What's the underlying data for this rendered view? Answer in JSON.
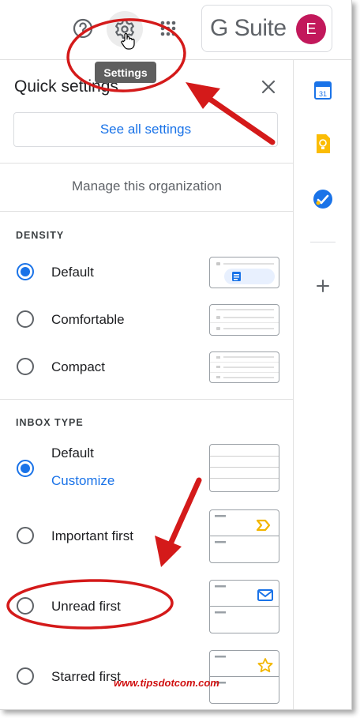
{
  "header": {
    "help_icon": "help-circle-icon",
    "settings_icon": "gear-icon",
    "apps_icon": "apps-grid-icon",
    "brand": "G Suite",
    "avatar_initial": "E",
    "avatar_color": "#c2185b",
    "tooltip": "Settings"
  },
  "panel": {
    "title": "Quick settings",
    "close_icon": "close-icon",
    "see_all_label": "See all settings",
    "manage_label": "Manage this organization"
  },
  "density": {
    "heading": "DENSITY",
    "options": [
      {
        "label": "Default",
        "selected": true
      },
      {
        "label": "Comfortable",
        "selected": false
      },
      {
        "label": "Compact",
        "selected": false
      }
    ]
  },
  "inbox_type": {
    "heading": "INBOX TYPE",
    "options": [
      {
        "label": "Default",
        "selected": true,
        "link": "Customize"
      },
      {
        "label": "Important first",
        "selected": false
      },
      {
        "label": "Unread first",
        "selected": false
      },
      {
        "label": "Starred first",
        "selected": false
      }
    ]
  },
  "sidebar": {
    "calendar_day": "31",
    "items": [
      "calendar-icon",
      "keep-icon",
      "tasks-icon",
      "add-icon"
    ]
  },
  "watermark": "www.tipsdotcom.com",
  "colors": {
    "accent": "#1a73e8",
    "annotation": "#d41a1a",
    "keep_yellow": "#fbbc04"
  }
}
